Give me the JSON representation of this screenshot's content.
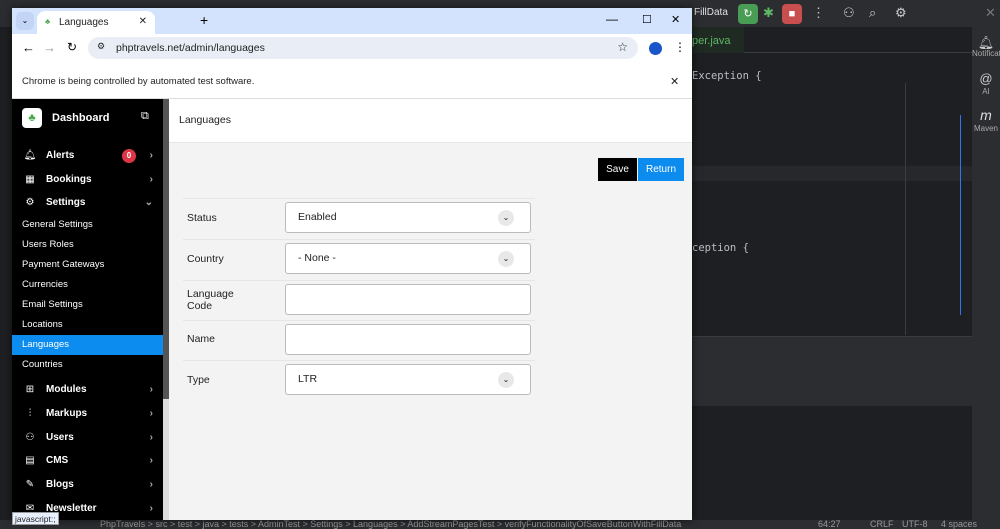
{
  "ide": {
    "run_config": "FillData",
    "file_tab": "per.java",
    "code_line1": "Exception {",
    "code_line2": "ception {",
    "right_tools": [
      "Notifications",
      "AI",
      "Maven"
    ],
    "status_path": "PhpTravels > src > test > java > tests > AdminTest > Settings > Languages > AddStreamPagesTest > verifyFunctionalityOfSaveButtonWithFillData",
    "cursor": "64:27",
    "line_sep": "CRLF",
    "encoding": "UTF-8",
    "indent": "4 spaces"
  },
  "browser": {
    "tab_title": "Languages",
    "url": "phptravels.net/admin/languages",
    "infobar": "Chrome is being controlled by automated test software.",
    "status_tooltip": "javascript:;"
  },
  "sidebar": {
    "brand": "Dashboard",
    "items": [
      {
        "label": "Alerts",
        "badge": "0"
      },
      {
        "label": "Bookings"
      },
      {
        "label": "Settings"
      }
    ],
    "settings_sub": [
      "General Settings",
      "Users Roles",
      "Payment Gateways",
      "Currencies",
      "Email Settings",
      "Locations",
      "Languages",
      "Countries"
    ],
    "more": [
      "Modules",
      "Markups",
      "Users",
      "CMS",
      "Blogs",
      "Newsletter"
    ]
  },
  "page": {
    "title": "Languages",
    "save": "Save",
    "return": "Return",
    "fields": {
      "status_label": "Status",
      "status_value": "Enabled",
      "country_label": "Country",
      "country_value": "- None -",
      "code_label": "Language Code",
      "code_value": "",
      "name_label": "Name",
      "name_value": "",
      "type_label": "Type",
      "type_value": "LTR"
    }
  },
  "colors": {
    "accent": "#0d8cf0",
    "badge": "#dc3545"
  }
}
